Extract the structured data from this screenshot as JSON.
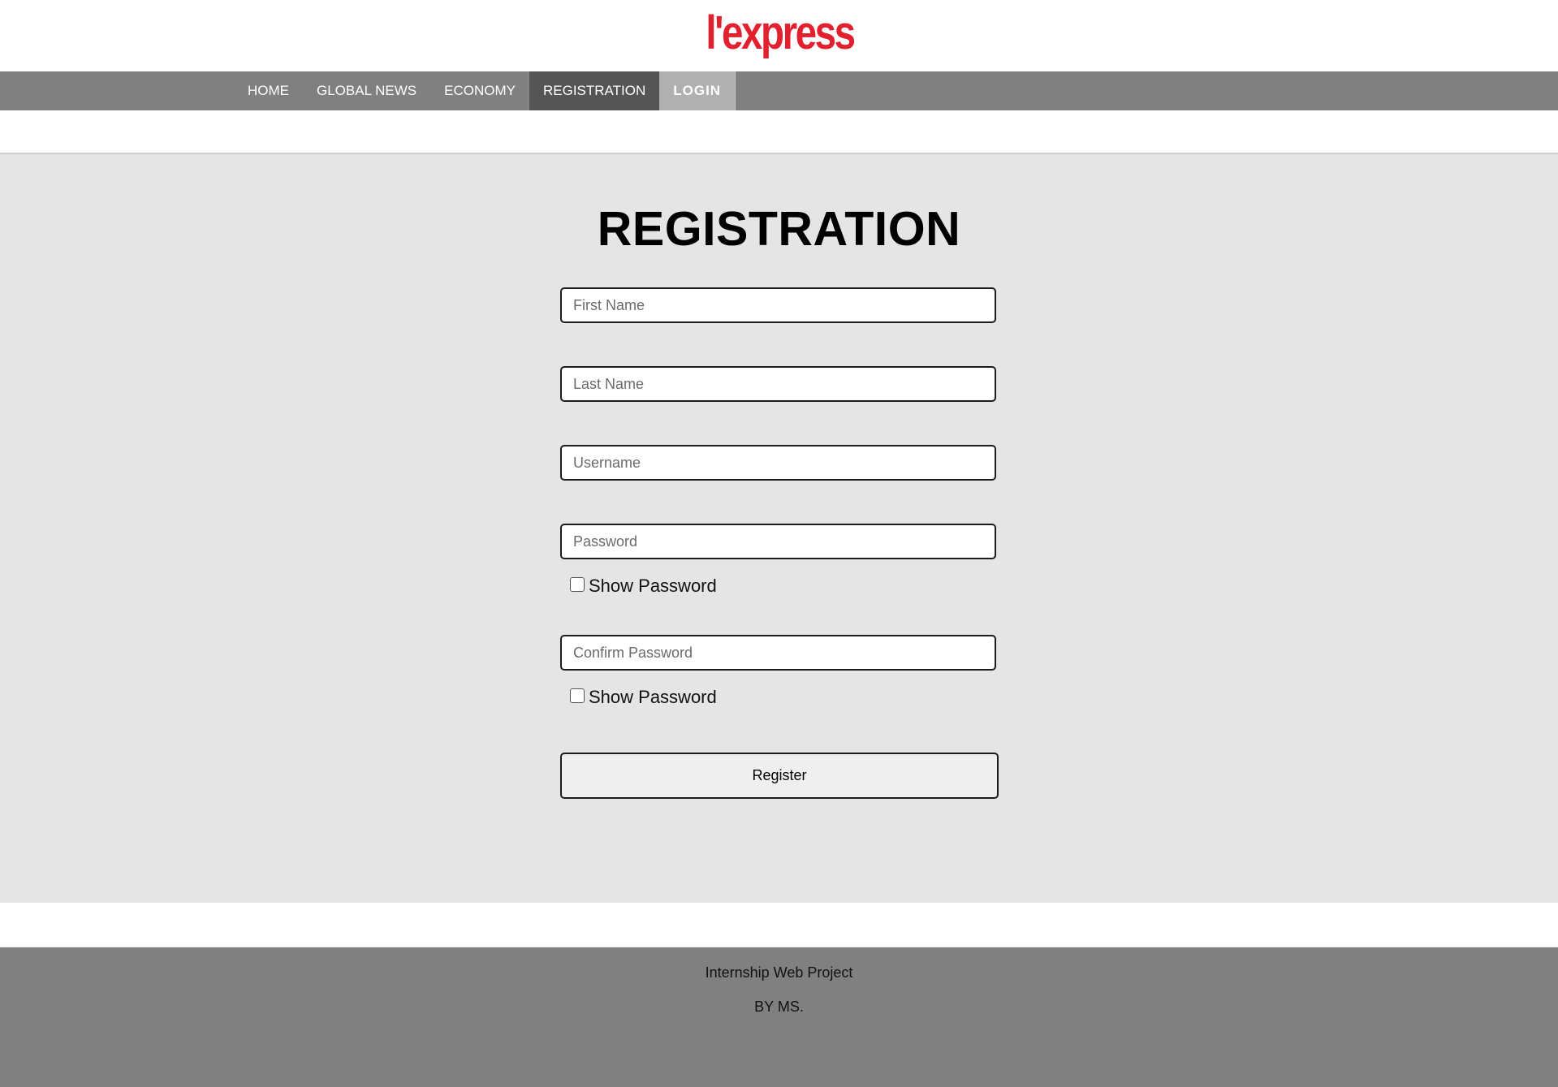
{
  "header": {
    "logo_text": "l'express"
  },
  "nav": {
    "items": [
      {
        "label": "HOME"
      },
      {
        "label": "GLOBAL NEWS"
      },
      {
        "label": "ECONOMY"
      },
      {
        "label": "REGISTRATION"
      },
      {
        "label": "LOGIN"
      }
    ],
    "active": "REGISTRATION"
  },
  "form": {
    "title": "REGISTRATION",
    "first_name": {
      "placeholder": "First Name",
      "value": ""
    },
    "last_name": {
      "placeholder": "Last Name",
      "value": ""
    },
    "username": {
      "placeholder": "Username",
      "value": ""
    },
    "password": {
      "placeholder": "Password",
      "value": ""
    },
    "password_toggle_label": "Show Password",
    "confirm_password": {
      "placeholder": "Confirm Password",
      "value": ""
    },
    "confirm_toggle_label": "Show Password",
    "submit_label": "Register"
  },
  "footer": {
    "line1": "Internship Web Project",
    "line2": "BY MS."
  },
  "colors": {
    "brand_red": "#e3202e",
    "nav_bg": "#808080",
    "nav_active": "#555555",
    "nav_login": "#b0b0b0",
    "main_bg": "#e5e5e5",
    "footer_bg": "#808080"
  }
}
